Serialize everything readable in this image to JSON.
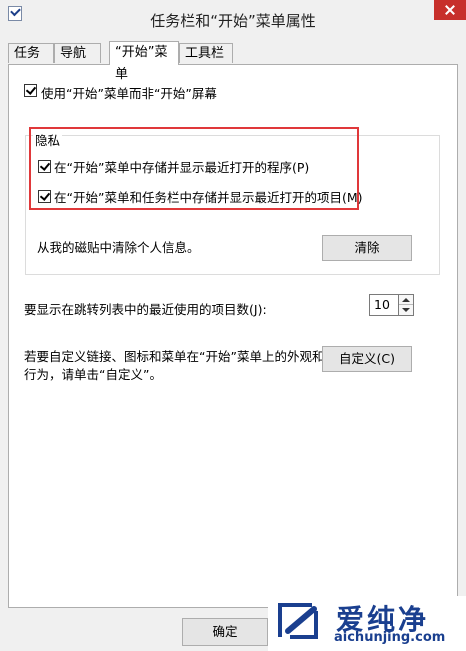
{
  "window": {
    "title": "任务栏和“开始”菜单属性"
  },
  "tabs": [
    {
      "label": "任务栏"
    },
    {
      "label": "导航"
    },
    {
      "label": "“开始”菜单"
    },
    {
      "label": "工具栏"
    }
  ],
  "use_start_menu": {
    "label": "使用“开始”菜单而非“开始”屏幕",
    "checked": true
  },
  "privacy": {
    "title": "隐私",
    "store_programs": {
      "label": "在“开始”菜单中存储并显示最近打开的程序(P)",
      "checked": true
    },
    "store_items": {
      "label": "在“开始”菜单和任务栏中存储并显示最近打开的项目(M)",
      "checked": true
    },
    "clear_text": "从我的磁贴中清除个人信息。",
    "clear_button": "清除"
  },
  "jump_list": {
    "label": "要显示在跳转列表中的最近使用的项目数(J):",
    "value": "10"
  },
  "customize": {
    "text_line1": "若要自定义链接、图标和菜单在“开始”菜单上的外观和",
    "text_line2": "行为，请单击“自定义”。",
    "button": "自定义(C)"
  },
  "footer": {
    "ok_button": "确定"
  },
  "watermark": {
    "name": "爱纯净",
    "url": "aichunjing.com"
  },
  "colors": {
    "highlight": "#e0383a",
    "close": "#c7302b",
    "watermark": "#1a3f8f"
  }
}
